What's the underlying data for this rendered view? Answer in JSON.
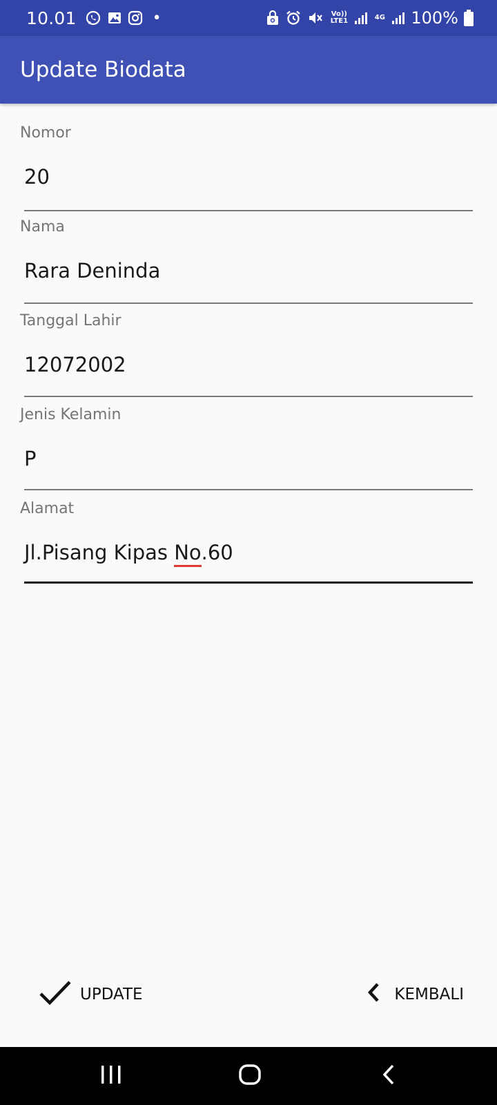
{
  "status_bar": {
    "time": "10.01",
    "battery": "100%",
    "volte_label": "Vo)) LTE1",
    "network_label": "4G"
  },
  "app_bar": {
    "title": "Update Biodata"
  },
  "form": {
    "fields": [
      {
        "label": "Nomor",
        "value": "20"
      },
      {
        "label": "Nama",
        "value": "Rara Deninda"
      },
      {
        "label": "Tanggal Lahir",
        "value": "12072002"
      },
      {
        "label": "Jenis Kelamin",
        "value": "P"
      },
      {
        "label": "Alamat",
        "value_before": "Jl.Pisang Kipas ",
        "value_misspelled": "No",
        "value_after": ".60"
      }
    ]
  },
  "actions": {
    "update_label": "UPDATE",
    "kembali_label": "KEMBALI"
  },
  "colors": {
    "status_bar": "#3344a8",
    "app_bar": "#3f51b5",
    "background": "#fafafa",
    "spell_underline": "#e53935"
  },
  "icons": {
    "update": "check-icon",
    "kembali": "chevron-left-icon",
    "nav_recent": "recent-apps-icon",
    "nav_home": "home-icon",
    "nav_back": "back-icon"
  }
}
